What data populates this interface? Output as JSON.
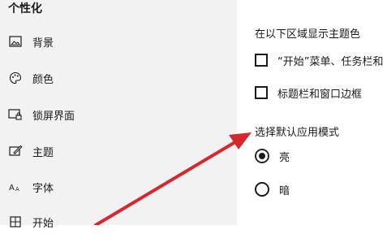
{
  "sidebar": {
    "title": "个性化",
    "items": [
      {
        "label": "背景",
        "icon": "image-icon"
      },
      {
        "label": "颜色",
        "icon": "palette-icon"
      },
      {
        "label": "锁屏界面",
        "icon": "lock-screen-icon"
      },
      {
        "label": "主题",
        "icon": "theme-icon"
      },
      {
        "label": "字体",
        "icon": "font-icon"
      },
      {
        "label": "开始",
        "icon": "start-icon"
      }
    ]
  },
  "main": {
    "accent_section_title": "在以下区域显示主题色",
    "accent_options": [
      {
        "label": "“开始”菜单、任务栏和",
        "checked": false
      },
      {
        "label": "标题栏和窗口边框",
        "checked": false
      }
    ],
    "mode_section_title": "选择默认应用模式",
    "mode_options": [
      {
        "label": "亮",
        "selected": true
      },
      {
        "label": "暗",
        "selected": false
      }
    ]
  },
  "colors": {
    "sidebar_bg": "#f2f2f2",
    "content_bg": "#ffffff",
    "annotation_arrow": "#d7262e"
  }
}
